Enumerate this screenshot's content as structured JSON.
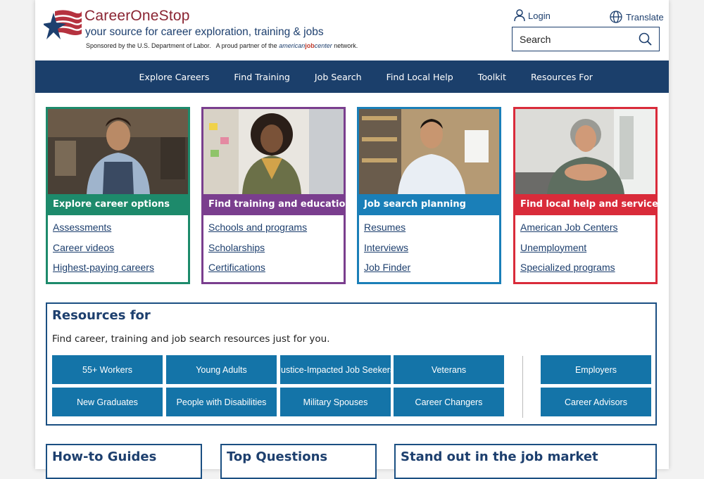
{
  "header": {
    "brand": "CareerOneStop",
    "tagline": "your source for career exploration, training & jobs",
    "sponsor_text": "Sponsored by the U.S. Department of Labor.",
    "partner_text": "A proud partner of the",
    "partner_brand_prefix": "american",
    "partner_brand_mid": "job",
    "partner_brand_suffix": "center",
    "partner_network": "network.",
    "login_label": "Login",
    "translate_label": "Translate",
    "search_placeholder": "Search"
  },
  "nav": {
    "items": [
      "Explore Careers",
      "Find Training",
      "Job Search",
      "Find Local Help",
      "Toolkit",
      "Resources For"
    ]
  },
  "cards": [
    {
      "title": "Explore career options",
      "color": "#1d8a6b",
      "links": [
        "Assessments",
        "Career videos",
        "Highest-paying careers"
      ]
    },
    {
      "title": "Find training and education",
      "color": "#7a3e8e",
      "links": [
        "Schools and programs",
        "Scholarships",
        "Certifications"
      ]
    },
    {
      "title": "Job search planning",
      "color": "#1a7fb8",
      "links": [
        "Resumes",
        "Interviews",
        "Job Finder"
      ]
    },
    {
      "title": "Find local help and services",
      "color": "#d92b3a",
      "links": [
        "American Job Centers",
        "Unemployment",
        "Specialized programs"
      ]
    }
  ],
  "resources": {
    "title": "Resources for",
    "description": "Find career, training and job search resources just for you.",
    "buttons": [
      "55+ Workers",
      "Young Adults",
      "Justice-Impacted Job Seekers",
      "Veterans",
      "New Graduates",
      "People with Disabilities",
      "Military Spouses",
      "Career Changers"
    ],
    "side_buttons": [
      "Employers",
      "Career Advisors"
    ],
    "button_color": "#1474a8"
  },
  "bottom": {
    "howto": "How-to Guides",
    "questions": "Top Questions",
    "standout": "Stand out in the job market"
  },
  "colors": {
    "nav_bg": "#1b3f6b",
    "brand_red": "#8a2432",
    "link_blue": "#1d3f6e"
  },
  "icons": [
    "star-flag-logo",
    "user-icon",
    "globe-icon",
    "search-icon"
  ]
}
